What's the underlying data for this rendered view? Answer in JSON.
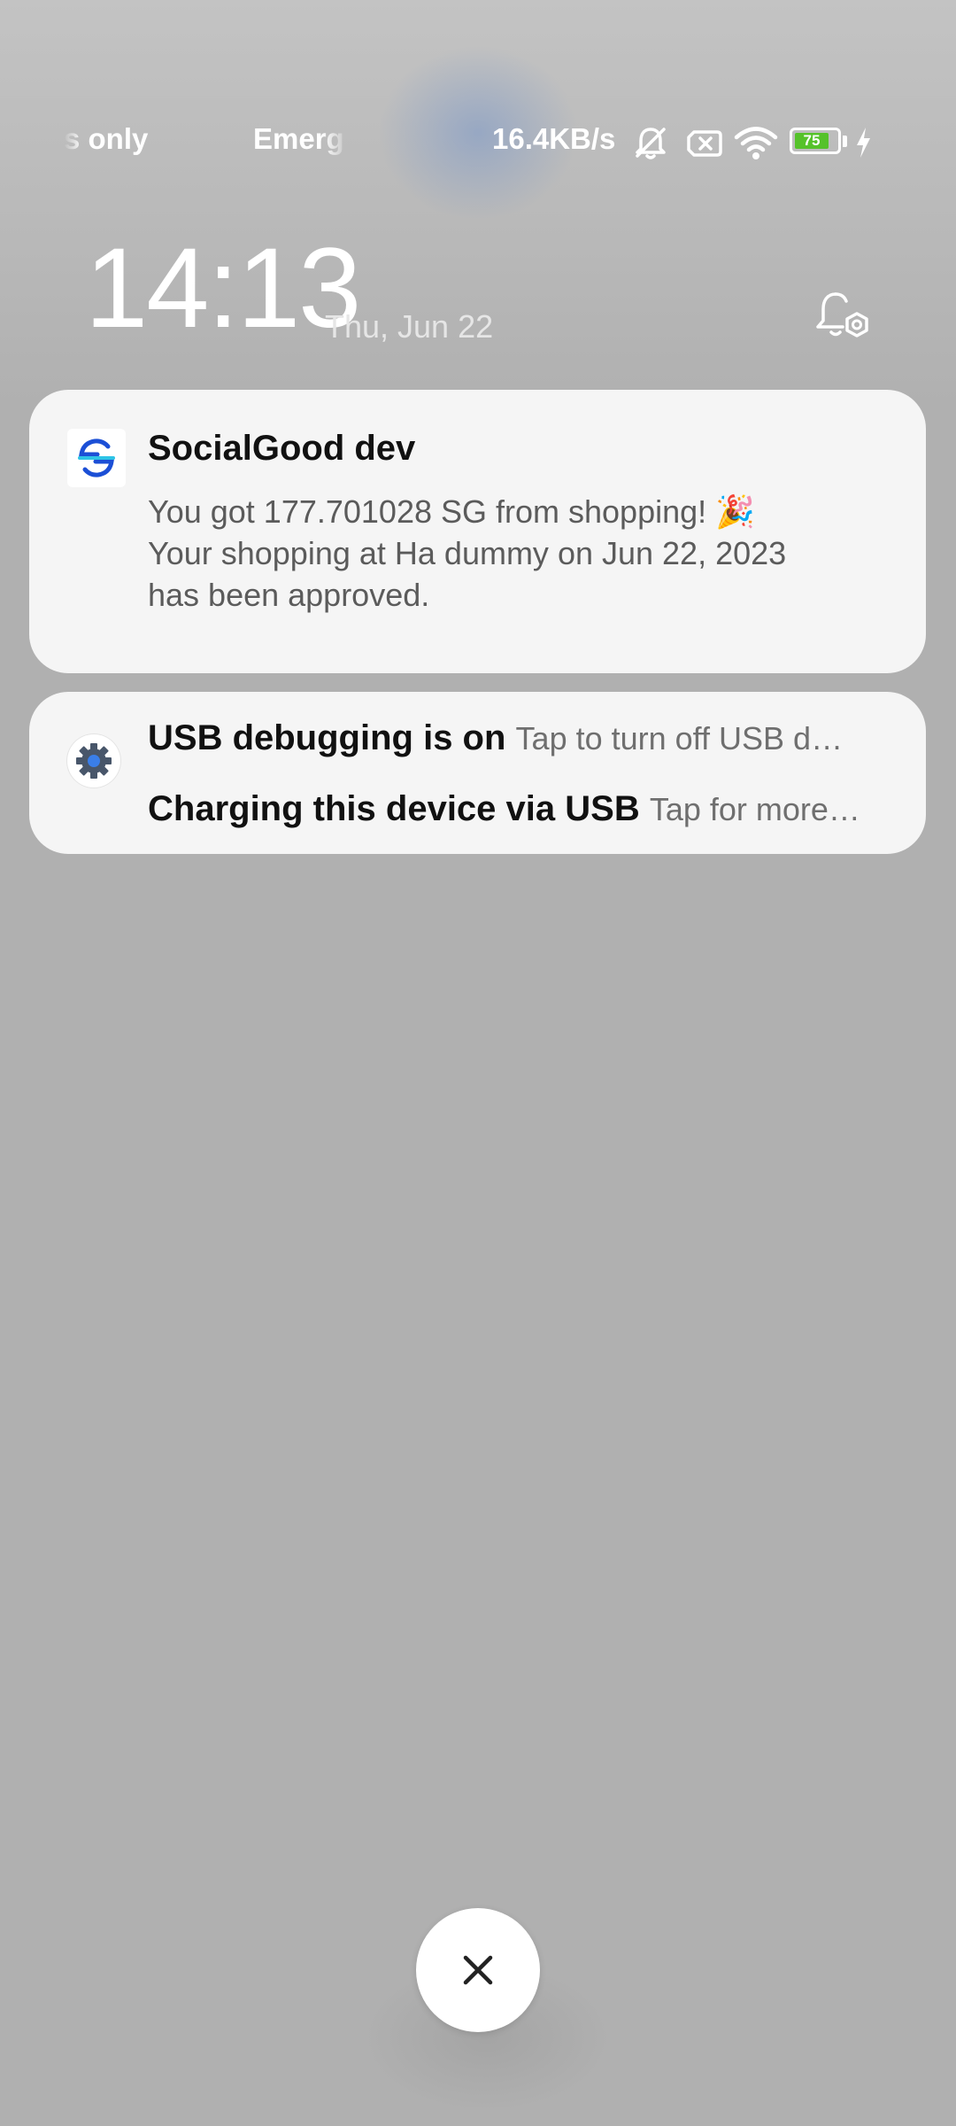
{
  "status_bar": {
    "carrier_1": "s only",
    "carrier_2": "Emerg",
    "net_speed": "16.4KB/s",
    "icons": [
      "mute-bell-icon",
      "no-sim-icon",
      "wifi-icon",
      "battery-icon",
      "charging-bolt-icon"
    ],
    "battery_level": "75",
    "battery_color": "#55c22a"
  },
  "lockscreen": {
    "time": "14:13",
    "date": "Thu, Jun 22",
    "notification_settings_icon": "bell-settings-icon"
  },
  "notifications": [
    {
      "app_name": "SocialGood dev",
      "icon": "socialgood-logo",
      "line_1": "You got 177.701028 SG from shopping! 🎉",
      "line_2": "Your shopping at Ha dummy on Jun 22, 2023",
      "line_3": "has been approved."
    },
    {
      "icon": "gear-icon",
      "items": [
        {
          "title": "USB debugging is on",
          "text": "Tap to turn off USB d…"
        },
        {
          "title": "Charging this device via USB",
          "text": "Tap for more…"
        }
      ]
    }
  ],
  "dismiss_button": {
    "icon": "close-icon"
  }
}
